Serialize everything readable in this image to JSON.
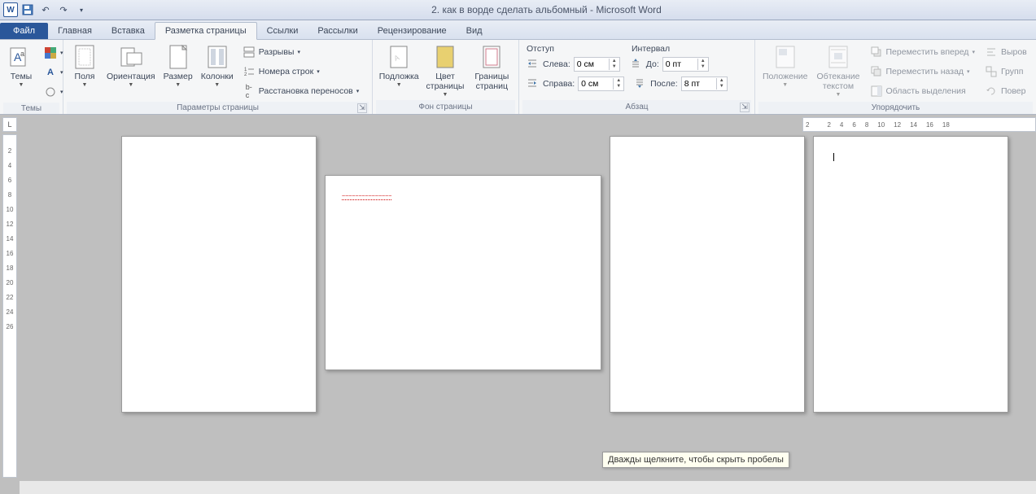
{
  "title": "2. как в ворде сделать альбомный - Microsoft Word",
  "qat": {
    "save": "save",
    "undo": "undo",
    "redo": "redo"
  },
  "tabs": {
    "file": "Файл",
    "items": [
      "Главная",
      "Вставка",
      "Разметка страницы",
      "Ссылки",
      "Рассылки",
      "Рецензирование",
      "Вид"
    ],
    "active_index": 2
  },
  "ribbon": {
    "themes": {
      "label": "Темы",
      "btn": "Темы"
    },
    "page_setup": {
      "label": "Параметры страницы",
      "margins": "Поля",
      "orientation": "Ориентация",
      "size": "Размер",
      "columns": "Колонки",
      "breaks": "Разрывы",
      "line_numbers": "Номера строк",
      "hyphenation": "Расстановка переносов"
    },
    "page_bg": {
      "label": "Фон страницы",
      "watermark": "Подложка",
      "page_color": "Цвет страницы",
      "page_borders": "Границы страниц"
    },
    "paragraph": {
      "label": "Абзац",
      "indent_header": "Отступ",
      "spacing_header": "Интервал",
      "left_label": "Слева:",
      "right_label": "Справа:",
      "before_label": "До:",
      "after_label": "После:",
      "left_val": "0 см",
      "right_val": "0 см",
      "before_val": "0 пт",
      "after_val": "8 пт"
    },
    "arrange": {
      "label": "Упорядочить",
      "position": "Положение",
      "wrap": "Обтекание текстом",
      "bring_forward": "Переместить вперед",
      "send_backward": "Переместить назад",
      "selection_pane": "Область выделения",
      "align": "Выров",
      "group": "Групп",
      "rotate": "Повер"
    }
  },
  "ruler": {
    "corner": "L",
    "h": [
      "2",
      "",
      "2",
      "4",
      "6",
      "8",
      "10",
      "12",
      "14",
      "16",
      "18"
    ],
    "v": [
      "",
      "2",
      "4",
      "6",
      "8",
      "10",
      "12",
      "14",
      "16",
      "18",
      "20",
      "22",
      "24",
      "26"
    ]
  },
  "tooltip": "Дважды щелкните, чтобы скрыть пробелы",
  "redline": "~~~~~~~~~~~~~~~"
}
